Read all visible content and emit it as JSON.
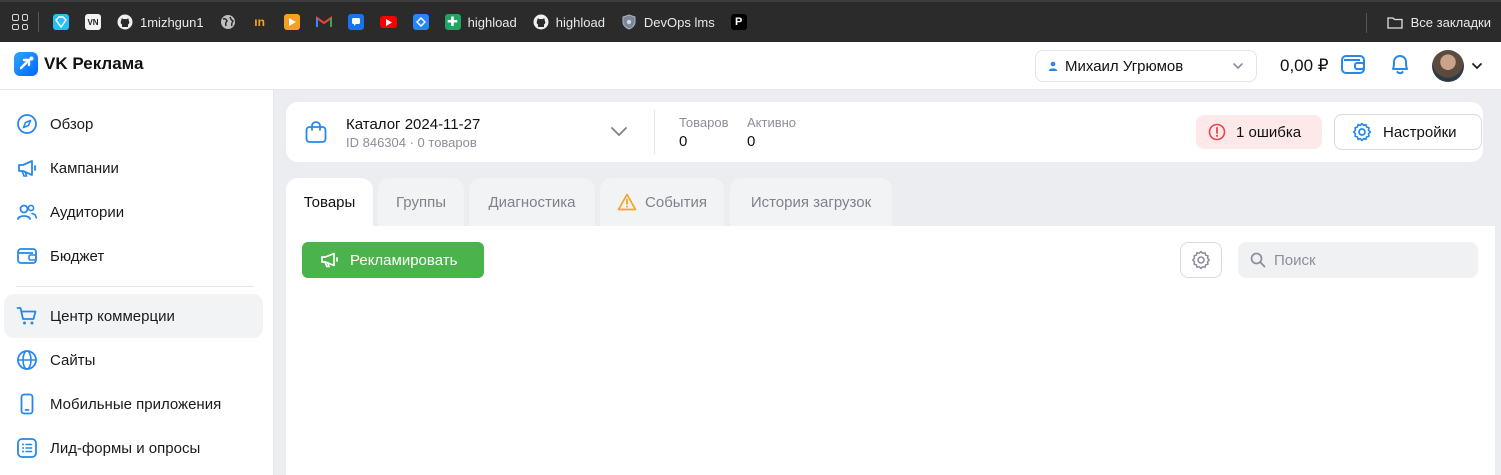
{
  "bookmarks_bar": {
    "items": [
      {
        "icon": "apps-grid-icon",
        "label": ""
      },
      {
        "icon": "gem-icon",
        "label": ""
      },
      {
        "icon": "vn-icon",
        "label": ""
      },
      {
        "icon": "github-icon",
        "label": "1mizhgun1"
      },
      {
        "icon": "globe-icon",
        "label": ""
      },
      {
        "icon": "in-icon",
        "label": ""
      },
      {
        "icon": "play-icon",
        "label": ""
      },
      {
        "icon": "gmail-icon",
        "label": ""
      },
      {
        "icon": "chat-icon",
        "label": ""
      },
      {
        "icon": "youtube-icon",
        "label": ""
      },
      {
        "icon": "jira-icon",
        "label": ""
      },
      {
        "icon": "plus-icon",
        "label": "highload"
      },
      {
        "icon": "github-icon",
        "label": "highload"
      },
      {
        "icon": "shield-icon",
        "label": "DevOps lms"
      },
      {
        "icon": "p-icon",
        "label": ""
      }
    ],
    "all_bookmarks_label": "Все закладки"
  },
  "header": {
    "logo_text": "VK Реклама",
    "account_name": "Михаил Угрюмов",
    "balance": "0,00 ₽"
  },
  "sidebar": {
    "items": [
      {
        "label": "Обзор",
        "icon": "compass-icon"
      },
      {
        "label": "Кампании",
        "icon": "megaphone-icon"
      },
      {
        "label": "Аудитории",
        "icon": "users-icon"
      },
      {
        "label": "Бюджет",
        "icon": "wallet-icon"
      },
      {
        "label": "Центр коммерции",
        "icon": "cart-icon",
        "active": true
      },
      {
        "label": "Сайты",
        "icon": "globe-icon"
      },
      {
        "label": "Мобильные приложения",
        "icon": "phone-icon"
      },
      {
        "label": "Лид-формы и опросы",
        "icon": "list-icon"
      }
    ]
  },
  "catalog": {
    "title": "Каталог 2024-11-27",
    "subtitle": "ID 846304 · 0 товаров",
    "stats": [
      {
        "label": "Товаров",
        "value": "0"
      },
      {
        "label": "Активно",
        "value": "0"
      }
    ],
    "error_label": "1 ошибка",
    "settings_label": "Настройки"
  },
  "tabs": [
    {
      "label": "Товары",
      "active": true
    },
    {
      "label": "Группы"
    },
    {
      "label": "Диагностика"
    },
    {
      "label": "События",
      "icon": "warning-icon"
    },
    {
      "label": "История загрузок"
    }
  ],
  "toolbar": {
    "promote_label": "Рекламировать",
    "search_placeholder": "Поиск"
  },
  "colors": {
    "accent_blue": "#2688eb",
    "promote_green": "#4bb34b",
    "error_bg": "#fde8ea",
    "error_red": "#e64646",
    "warning_orange": "#f5a623"
  }
}
